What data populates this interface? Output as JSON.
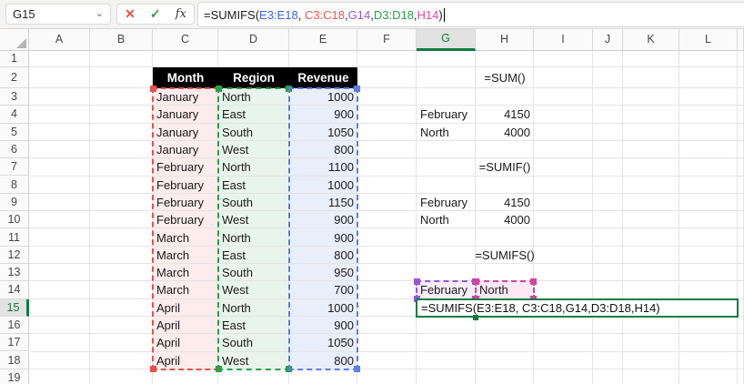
{
  "formula_bar": {
    "cell_reference": "G15",
    "chevron": "⌄",
    "cancel_label": "✕",
    "enter_label": "✓",
    "fx_label": "fx",
    "formula_tokens": [
      {
        "text": "=SUMIFS(",
        "color": "#1a1a1a"
      },
      {
        "text": "E3:E18",
        "color": "#3b64e8"
      },
      {
        "text": ", ",
        "color": "#1a1a1a"
      },
      {
        "text": "C3:C18",
        "color": "#ef5350"
      },
      {
        "text": ",",
        "color": "#1a1a1a"
      },
      {
        "text": "G14",
        "color": "#9a55d8"
      },
      {
        "text": ",",
        "color": "#1a1a1a"
      },
      {
        "text": "D3:D18",
        "color": "#28a244"
      },
      {
        "text": ",",
        "color": "#1a1a1a"
      },
      {
        "text": "H14",
        "color": "#e8459b"
      },
      {
        "text": ")",
        "color": "#1a1a1a"
      }
    ],
    "has_cursor": true
  },
  "grid": {
    "column_labels": [
      "A",
      "B",
      "C",
      "D",
      "E",
      "F",
      "G",
      "H",
      "I",
      "J",
      "K",
      "L",
      ""
    ],
    "row_labels": [
      "1",
      "2",
      "3",
      "4",
      "5",
      "6",
      "7",
      "8",
      "9",
      "10",
      "11",
      "12",
      "13",
      "14",
      "15",
      "16",
      "17",
      "18",
      "19"
    ],
    "selected_column": "G",
    "selected_row": "15",
    "accent_color": "#107c41"
  },
  "table": {
    "headers": [
      {
        "col": "C",
        "label": "Month"
      },
      {
        "col": "D",
        "label": "Region"
      },
      {
        "col": "E",
        "label": "Revenue"
      }
    ],
    "rows": [
      {
        "month": "January",
        "region": "North",
        "revenue": "1000"
      },
      {
        "month": "January",
        "region": "East",
        "revenue": "900"
      },
      {
        "month": "January",
        "region": "South",
        "revenue": "1050"
      },
      {
        "month": "January",
        "region": "West",
        "revenue": "800"
      },
      {
        "month": "February",
        "region": "North",
        "revenue": "1100"
      },
      {
        "month": "February",
        "region": "East",
        "revenue": "1000"
      },
      {
        "month": "February",
        "region": "South",
        "revenue": "1150"
      },
      {
        "month": "February",
        "region": "West",
        "revenue": "900"
      },
      {
        "month": "March",
        "region": "North",
        "revenue": "900"
      },
      {
        "month": "March",
        "region": "East",
        "revenue": "800"
      },
      {
        "month": "March",
        "region": "South",
        "revenue": "950"
      },
      {
        "month": "March",
        "region": "West",
        "revenue": "700"
      },
      {
        "month": "April",
        "region": "North",
        "revenue": "1000"
      },
      {
        "month": "April",
        "region": "East",
        "revenue": "900"
      },
      {
        "month": "April",
        "region": "South",
        "revenue": "1050"
      },
      {
        "month": "April",
        "region": "West",
        "revenue": "800"
      }
    ]
  },
  "helper_cells": [
    {
      "ref": "H2",
      "text": "=SUM()",
      "align": "center"
    },
    {
      "ref": "G4",
      "text": "February",
      "align": "left"
    },
    {
      "ref": "H4",
      "text": "4150",
      "align": "right"
    },
    {
      "ref": "G5",
      "text": "North",
      "align": "left"
    },
    {
      "ref": "H5",
      "text": "4000",
      "align": "right"
    },
    {
      "ref": "H7",
      "text": "=SUMIF()",
      "align": "center"
    },
    {
      "ref": "G9",
      "text": "February",
      "align": "left"
    },
    {
      "ref": "H9",
      "text": "4150",
      "align": "right"
    },
    {
      "ref": "G10",
      "text": "North",
      "align": "left"
    },
    {
      "ref": "H10",
      "text": "4000",
      "align": "right"
    },
    {
      "ref": "H12",
      "text": "=SUMIFS()",
      "align": "center"
    },
    {
      "ref": "G14",
      "text": "February",
      "align": "left"
    },
    {
      "ref": "H14",
      "text": "North",
      "align": "left"
    }
  ],
  "selections": [
    {
      "range": "C3:C18",
      "border": "#e8514d",
      "fill": "#fdecec",
      "handles": [
        "tl",
        "bl"
      ]
    },
    {
      "range": "D3:D18",
      "border": "#28a244",
      "fill": "#e9f4ec",
      "handles": [
        "tl",
        "tr",
        "bl",
        "br"
      ]
    },
    {
      "range": "E3:E18",
      "border": "#5b7de8",
      "fill": "#e9eefb",
      "handles": [
        "tr",
        "br"
      ]
    },
    {
      "range": "G14:G14",
      "border": "#9a55d8",
      "fill": "#f6eefb",
      "handles": [
        "tl",
        "tr",
        "bl",
        "br"
      ]
    },
    {
      "range": "H14:H14",
      "border": "#d5439a",
      "fill": "#fbe9f3",
      "handles": [
        "tl",
        "tr",
        "bl",
        "br"
      ]
    }
  ],
  "edit_cell": {
    "cell": "G15",
    "box_range": "G15:L15",
    "formula": "=SUMIFS(E3:E18, C3:C18,G14,D3:D18,H14)",
    "border_color": "#107c41"
  }
}
